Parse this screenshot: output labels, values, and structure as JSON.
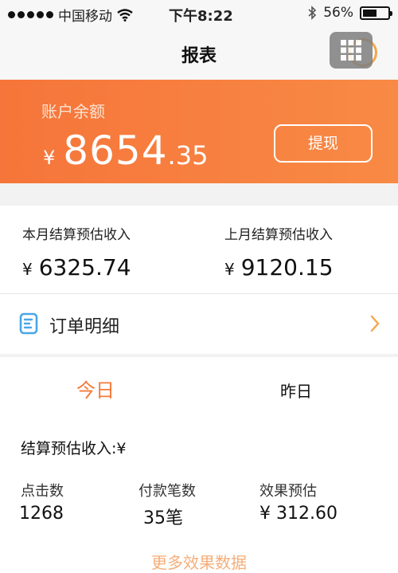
{
  "status_bar": {
    "carrier": "中国移动",
    "time": "下午8:22",
    "battery": "56%",
    "battery_level": 0.56
  },
  "nav": {
    "title": "报表"
  },
  "balance": {
    "label": "账户余额",
    "currency": "¥",
    "amount_int": "8654",
    "amount_dec": ".35",
    "withdraw_label": "提现"
  },
  "income": {
    "this_month": {
      "label": "本月结算预估收入",
      "currency": "¥",
      "value": "6325.74"
    },
    "last_month": {
      "label": "上月结算预估收入",
      "currency": "¥",
      "value": "9120.15"
    }
  },
  "order_detail": {
    "label": "订单明细"
  },
  "tabs": {
    "today": "今日",
    "yesterday": "昨日"
  },
  "settlement": {
    "label": "结算预估收入:¥"
  },
  "stats": [
    {
      "label": "点击数",
      "value": "1268"
    },
    {
      "label": "付款笔数",
      "value": "35笔"
    },
    {
      "label": "效果预估",
      "value": "¥ 312.60"
    }
  ],
  "more_link": "更多效果数据",
  "colors": {
    "accent": "#f6753a",
    "tab_active": "#f47a3a"
  }
}
